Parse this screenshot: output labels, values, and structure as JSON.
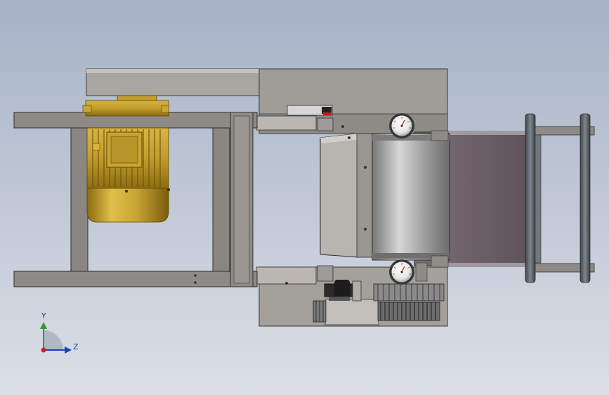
{
  "triad": {
    "y_label": "Y",
    "z_label": "Z",
    "y_color": "#2e9c2e",
    "z_color": "#1f3fb8",
    "origin_color": "#d02020"
  },
  "colors": {
    "background_top": "#a6b3c7",
    "background_bottom": "#dcdfe6",
    "frame": "#8d8a86",
    "housing": "#9c9894",
    "motor": "#c9a534",
    "belt": "#6f6269",
    "gauge_face": "#f2f2f2"
  }
}
